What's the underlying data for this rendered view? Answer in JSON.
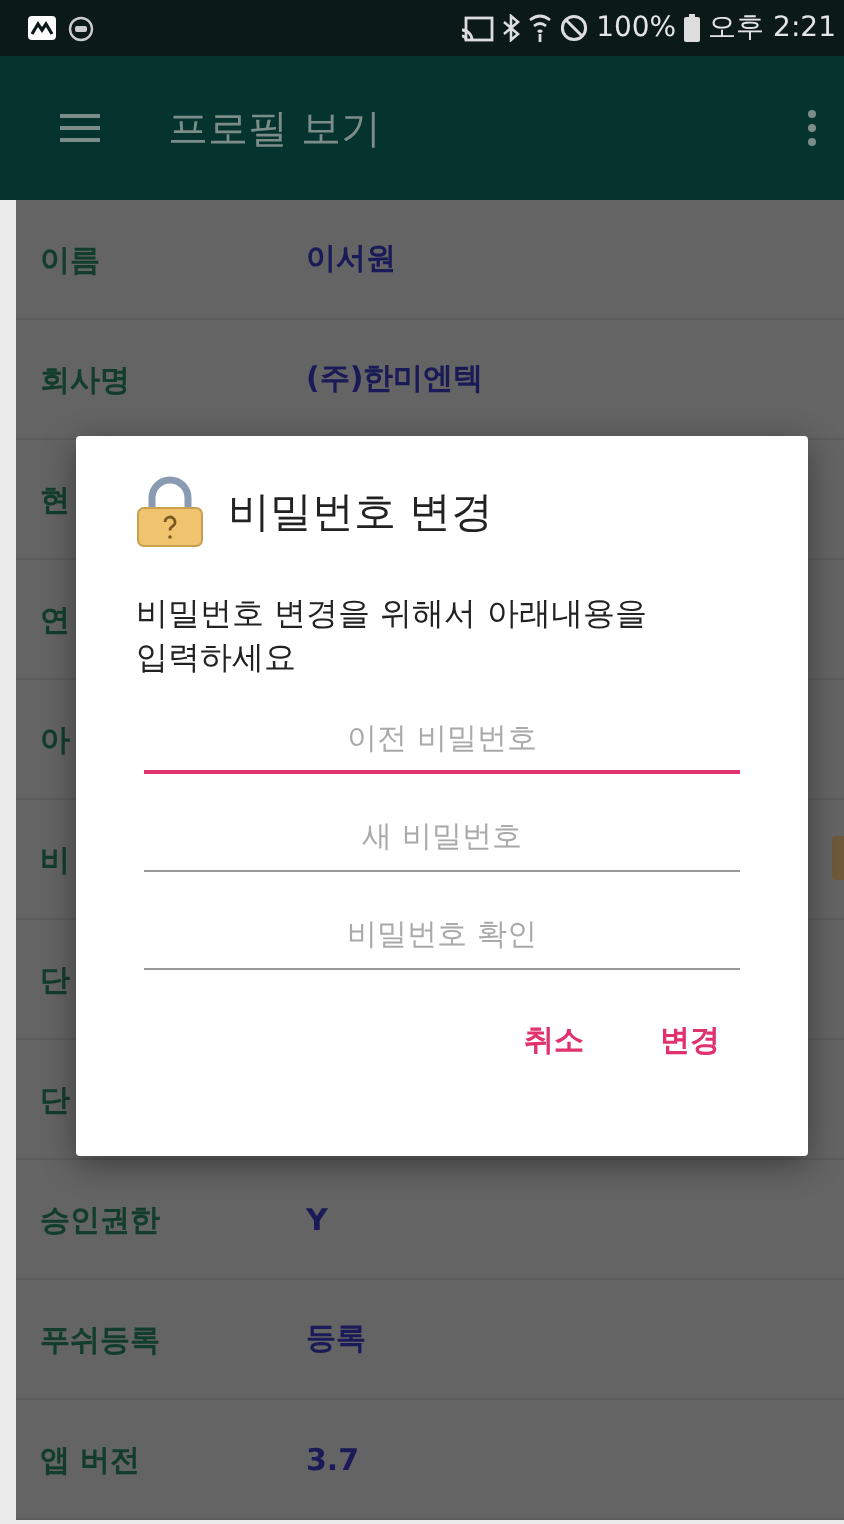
{
  "status_bar": {
    "battery": "100%",
    "time": "오후 2:21"
  },
  "app_bar": {
    "title": "프로필 보기"
  },
  "profile_rows": [
    {
      "label": "이름",
      "value": "이서원",
      "has_button": false
    },
    {
      "label": "회사명",
      "value": "(주)한미엔텍",
      "has_button": false
    },
    {
      "label": "현",
      "has_button": false
    },
    {
      "label": "연",
      "has_button": false
    },
    {
      "label": "아",
      "has_button": false
    },
    {
      "label": "비",
      "has_button": true
    },
    {
      "label": "단",
      "has_button": false
    },
    {
      "label": "단",
      "has_button": false
    },
    {
      "label": "승인권한",
      "value": "Y",
      "has_button": false
    },
    {
      "label": "푸쉬등록",
      "value": "등록",
      "has_button": false
    },
    {
      "label": "앱 버전",
      "value": "3.7",
      "has_button": false
    }
  ],
  "dialog": {
    "title": "비밀번호 변경",
    "message": "비밀번호 변경을 위해서 아래내용을\n입력하세요",
    "fields": [
      {
        "placeholder": "이전 비밀번호",
        "focused": true
      },
      {
        "placeholder": "새 비밀번호",
        "focused": false
      },
      {
        "placeholder": "비밀번호 확인",
        "focused": false
      }
    ],
    "buttons": [
      {
        "label": "취소"
      },
      {
        "label": "변경"
      }
    ]
  }
}
